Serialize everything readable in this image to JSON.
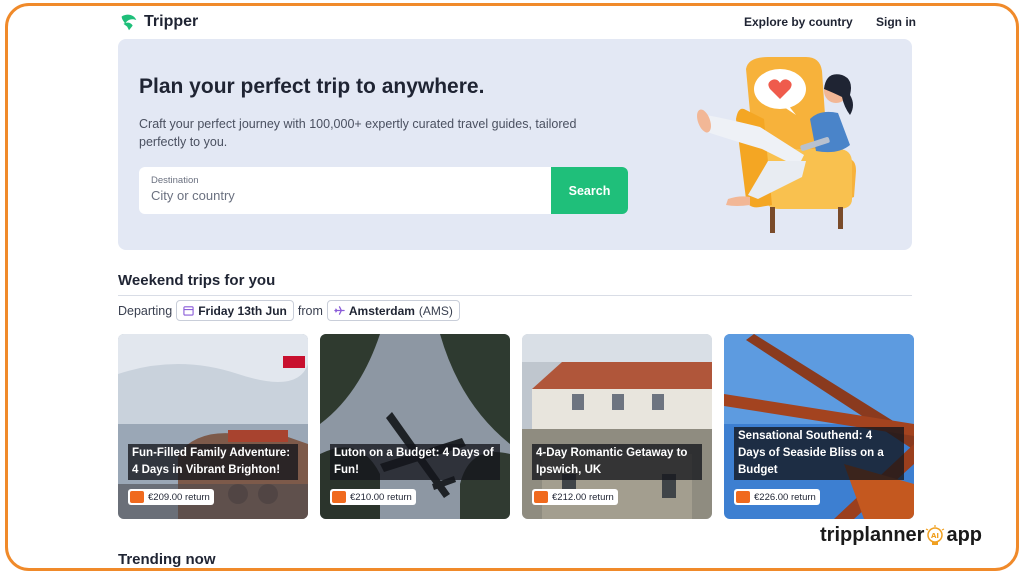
{
  "header": {
    "brand": "Tripper",
    "nav": [
      {
        "label": "Explore by country"
      },
      {
        "label": "Sign in"
      }
    ]
  },
  "hero": {
    "title": "Plan your perfect trip to anywhere.",
    "subtitle": "Craft your perfect journey with 100,000+ expertly curated travel guides, tailored perfectly to you.",
    "search": {
      "label": "Destination",
      "placeholder": "City or country",
      "button": "Search"
    }
  },
  "weekend": {
    "title": "Weekend trips for you",
    "departing_label": "Departing",
    "date": "Friday 13th Jun",
    "from_label": "from",
    "origin_city": "Amsterdam",
    "origin_code": "(AMS)",
    "cards": [
      {
        "title": "Fun-Filled Family Adventure: 4 Days in Vibrant Brighton!",
        "price": "€209.00 return"
      },
      {
        "title": "Luton on a Budget: 4 Days of Fun!",
        "price": "€210.00 return"
      },
      {
        "title": "4-Day Romantic Getaway to Ipswich, UK",
        "price": "€212.00 return"
      },
      {
        "title": "Sensational Southend: 4 Days of Seaside Bliss on a Budget",
        "price": "€226.00 return"
      }
    ]
  },
  "trending": {
    "title": "Trending now"
  },
  "watermark": {
    "left": "tripplanner",
    "right": "app",
    "badge": "AI"
  },
  "colors": {
    "accent": "#1fbf7a",
    "frame": "#f08a2a",
    "hero_bg": "#e3e8f4",
    "airline": "#f06a1e"
  }
}
